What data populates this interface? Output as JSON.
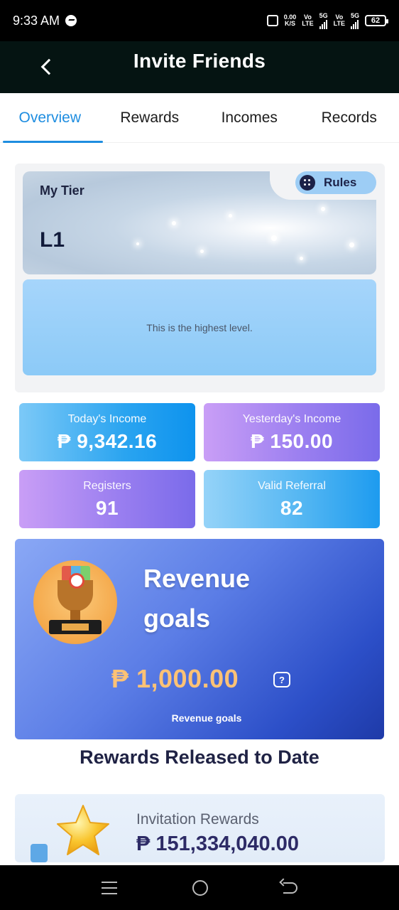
{
  "status_bar": {
    "time": "9:33 AM",
    "net_speed": "0.00",
    "net_unit": "K/S",
    "sim1_top": "Vo",
    "sim1_bottom": "LTE",
    "sim1_gen": "5G",
    "sim2_top": "Vo",
    "sim2_bottom": "LTE",
    "sim2_gen": "5G",
    "battery": "62"
  },
  "header": {
    "title": "Invite Friends"
  },
  "tabs": [
    {
      "label": "Overview",
      "active": true
    },
    {
      "label": "Rewards",
      "active": false
    },
    {
      "label": "Incomes",
      "active": false
    },
    {
      "label": "Records",
      "active": false
    }
  ],
  "tier": {
    "label": "My Tier",
    "value": "L1",
    "rules_label": "Rules",
    "info_text": "This is the highest level."
  },
  "stats": {
    "today": {
      "label": "Today's Income",
      "value": "₱ 9,342.16"
    },
    "yesterday": {
      "label": "Yesterday's Income",
      "value": "₱ 150.00"
    },
    "registers": {
      "label": "Registers",
      "value": "91"
    },
    "valid_referral": {
      "label": "Valid Referral",
      "value": "82"
    }
  },
  "revenue": {
    "title": "Revenue goals",
    "amount": "₱ 1,000.00",
    "help_symbol": "?",
    "caption": "Revenue goals"
  },
  "rewards_released": {
    "title": "Rewards Released to Date",
    "invitation_label": "Invitation Rewards",
    "invitation_amount": "₱ 151,334,040.00"
  },
  "colors": {
    "accent": "#1e8de0",
    "header_bg": "#051412",
    "revenue_amount": "#fcc276",
    "dark_text": "#1f2244"
  }
}
